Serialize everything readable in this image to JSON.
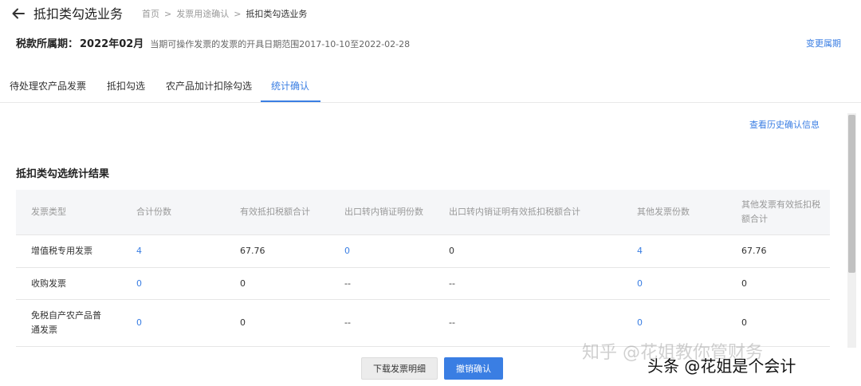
{
  "header": {
    "title": "抵扣类勾选业务",
    "breadcrumb": [
      "首页",
      "发票用途确认",
      "抵扣类勾选业务"
    ]
  },
  "period": {
    "label": "税款所属期：",
    "value": "2022年02月",
    "hint": "当期可操作发票的发票的开具日期范围2017-10-10至2022-02-28",
    "change_link": "变更属期"
  },
  "tabs": [
    {
      "label": "待处理农产品发票",
      "active": false
    },
    {
      "label": "抵扣勾选",
      "active": false
    },
    {
      "label": "农产品加计扣除勾选",
      "active": false
    },
    {
      "label": "统计确认",
      "active": true
    }
  ],
  "history_link": "查看历史确认信息",
  "section_title": "抵扣类勾选统计结果",
  "table": {
    "columns": [
      "发票类型",
      "合计份数",
      "有效抵扣税额合计",
      "出口转内销证明份数",
      "出口转内销证明有效抵扣税额合计",
      "其他发票份数",
      "其他发票有效抵扣税额合计"
    ],
    "rows": [
      [
        "增值税专用发票",
        "4",
        "67.76",
        "0",
        "0",
        "4",
        "67.76"
      ],
      [
        "收购发票",
        "0",
        "0",
        "--",
        "--",
        "0",
        "0"
      ],
      [
        "免税自产农产品普通发票",
        "0",
        "0",
        "--",
        "--",
        "0",
        "0"
      ]
    ]
  },
  "buttons": {
    "download": "下载发票明细",
    "revoke": "撤销确认"
  },
  "watermarks": {
    "zhihu": "知乎 @花姐教你管财务",
    "toutiao": "头条 @花姐是个会计"
  },
  "colors": {
    "accent": "#3a7ee3",
    "header_bg": "#f5f6f8"
  }
}
